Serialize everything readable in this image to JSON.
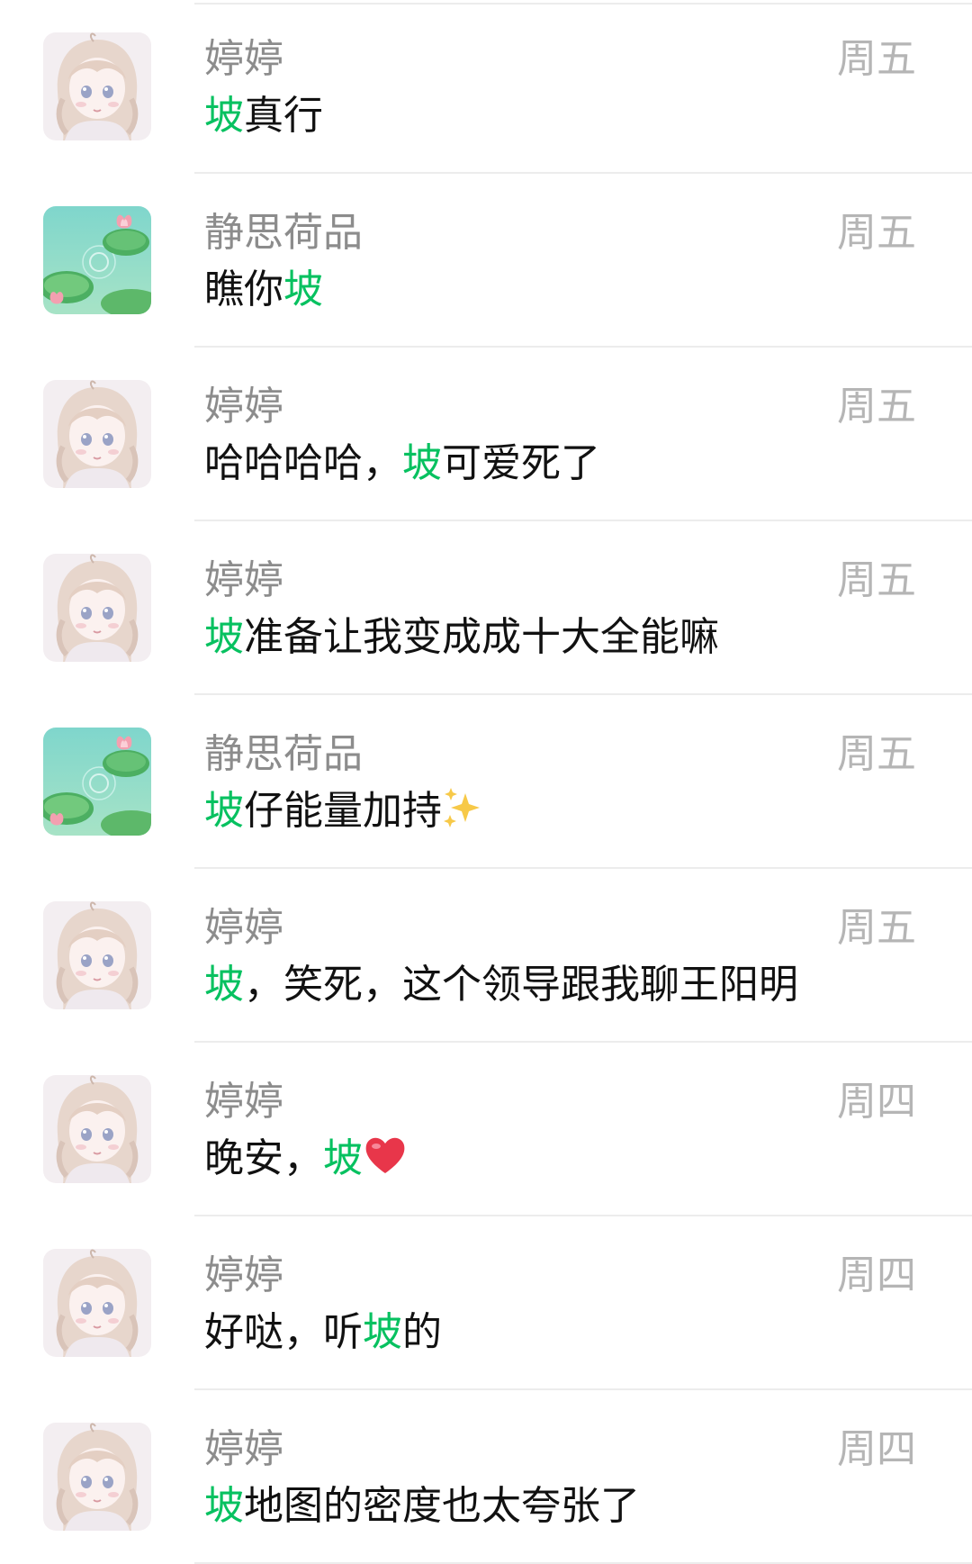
{
  "colors": {
    "keyword_highlight": "#07c160",
    "name_text": "#8c8c8c",
    "time_text": "#b5b5b5",
    "message_text": "#111111",
    "divider": "#ececec"
  },
  "messages": [
    {
      "avatar": "girl-avatar",
      "name": "婷婷",
      "time": "周五",
      "parts": [
        {
          "text": "坡",
          "hl": true
        },
        {
          "text": "真行"
        }
      ]
    },
    {
      "avatar": "lotus-avatar",
      "name": "静思荷品",
      "time": "周五",
      "parts": [
        {
          "text": "瞧你"
        },
        {
          "text": "坡",
          "hl": true
        }
      ]
    },
    {
      "avatar": "girl-avatar",
      "name": "婷婷",
      "time": "周五",
      "parts": [
        {
          "text": "哈哈哈哈，"
        },
        {
          "text": "坡",
          "hl": true
        },
        {
          "text": "可爱死了"
        }
      ]
    },
    {
      "avatar": "girl-avatar",
      "name": "婷婷",
      "time": "周五",
      "parts": [
        {
          "text": "坡",
          "hl": true
        },
        {
          "text": "准备让我变成成十大全能嘛"
        }
      ]
    },
    {
      "avatar": "lotus-avatar",
      "name": "静思荷品",
      "time": "周五",
      "parts": [
        {
          "text": "坡",
          "hl": true
        },
        {
          "text": "仔能量加持"
        }
      ],
      "emoji": "sparkles-icon"
    },
    {
      "avatar": "girl-avatar",
      "name": "婷婷",
      "time": "周五",
      "parts": [
        {
          "text": "坡",
          "hl": true
        },
        {
          "text": "，笑死，这个领导跟我聊王阳明"
        }
      ]
    },
    {
      "avatar": "girl-avatar",
      "name": "婷婷",
      "time": "周四",
      "parts": [
        {
          "text": "晚安，"
        },
        {
          "text": "坡",
          "hl": true
        }
      ],
      "emoji": "red-heart-icon"
    },
    {
      "avatar": "girl-avatar",
      "name": "婷婷",
      "time": "周四",
      "parts": [
        {
          "text": "好哒，听"
        },
        {
          "text": "坡",
          "hl": true
        },
        {
          "text": "的"
        }
      ]
    },
    {
      "avatar": "girl-avatar",
      "name": "婷婷",
      "time": "周四",
      "parts": [
        {
          "text": "坡",
          "hl": true
        },
        {
          "text": "地图的密度也太夸张了"
        }
      ]
    }
  ]
}
